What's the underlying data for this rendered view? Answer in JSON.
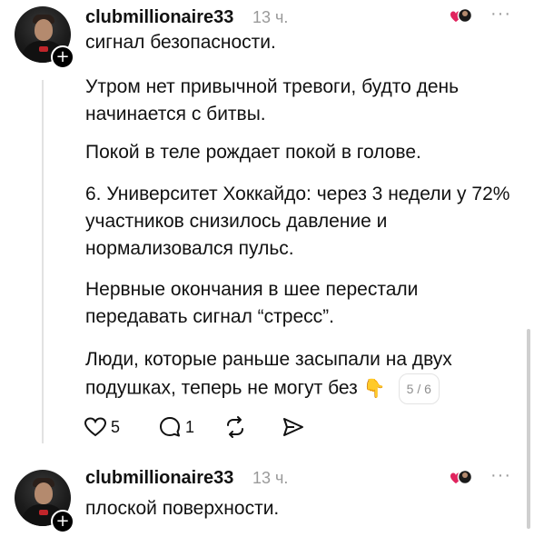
{
  "posts": [
    {
      "username": "clubmillionaire33",
      "timestamp": "13 ч.",
      "paragraphs": [
        "сигнал безопасности.",
        "Утром нет привычной тревоги, будто день начинается с битвы.",
        "Покой в теле рождает покой в голове.",
        "6. Университет Хоккайдо: через 3 недели у 72% участников снизилось давление и нормализовался пульс.",
        "Нервные окончания в шее перестали передавать сигнал “стресс”.",
        "Люди, которые раньше засыпали на двух подушках, теперь не могут без"
      ],
      "trailing_emoji": "👇",
      "page_indicator": "5 / 6",
      "actions": {
        "likes": "5",
        "replies": "1"
      },
      "more_label": "···",
      "icons": [
        "like-icon",
        "reply-icon",
        "repost-icon",
        "share-icon",
        "reaction-icon",
        "more-icon"
      ]
    },
    {
      "username": "clubmillionaire33",
      "timestamp": "13 ч.",
      "paragraphs": [
        "плоской поверхности."
      ],
      "more_label": "···"
    }
  ],
  "colors": {
    "heart": "#e0245e",
    "secondary_text": "#9a9a9a",
    "primary_text": "#111111"
  }
}
